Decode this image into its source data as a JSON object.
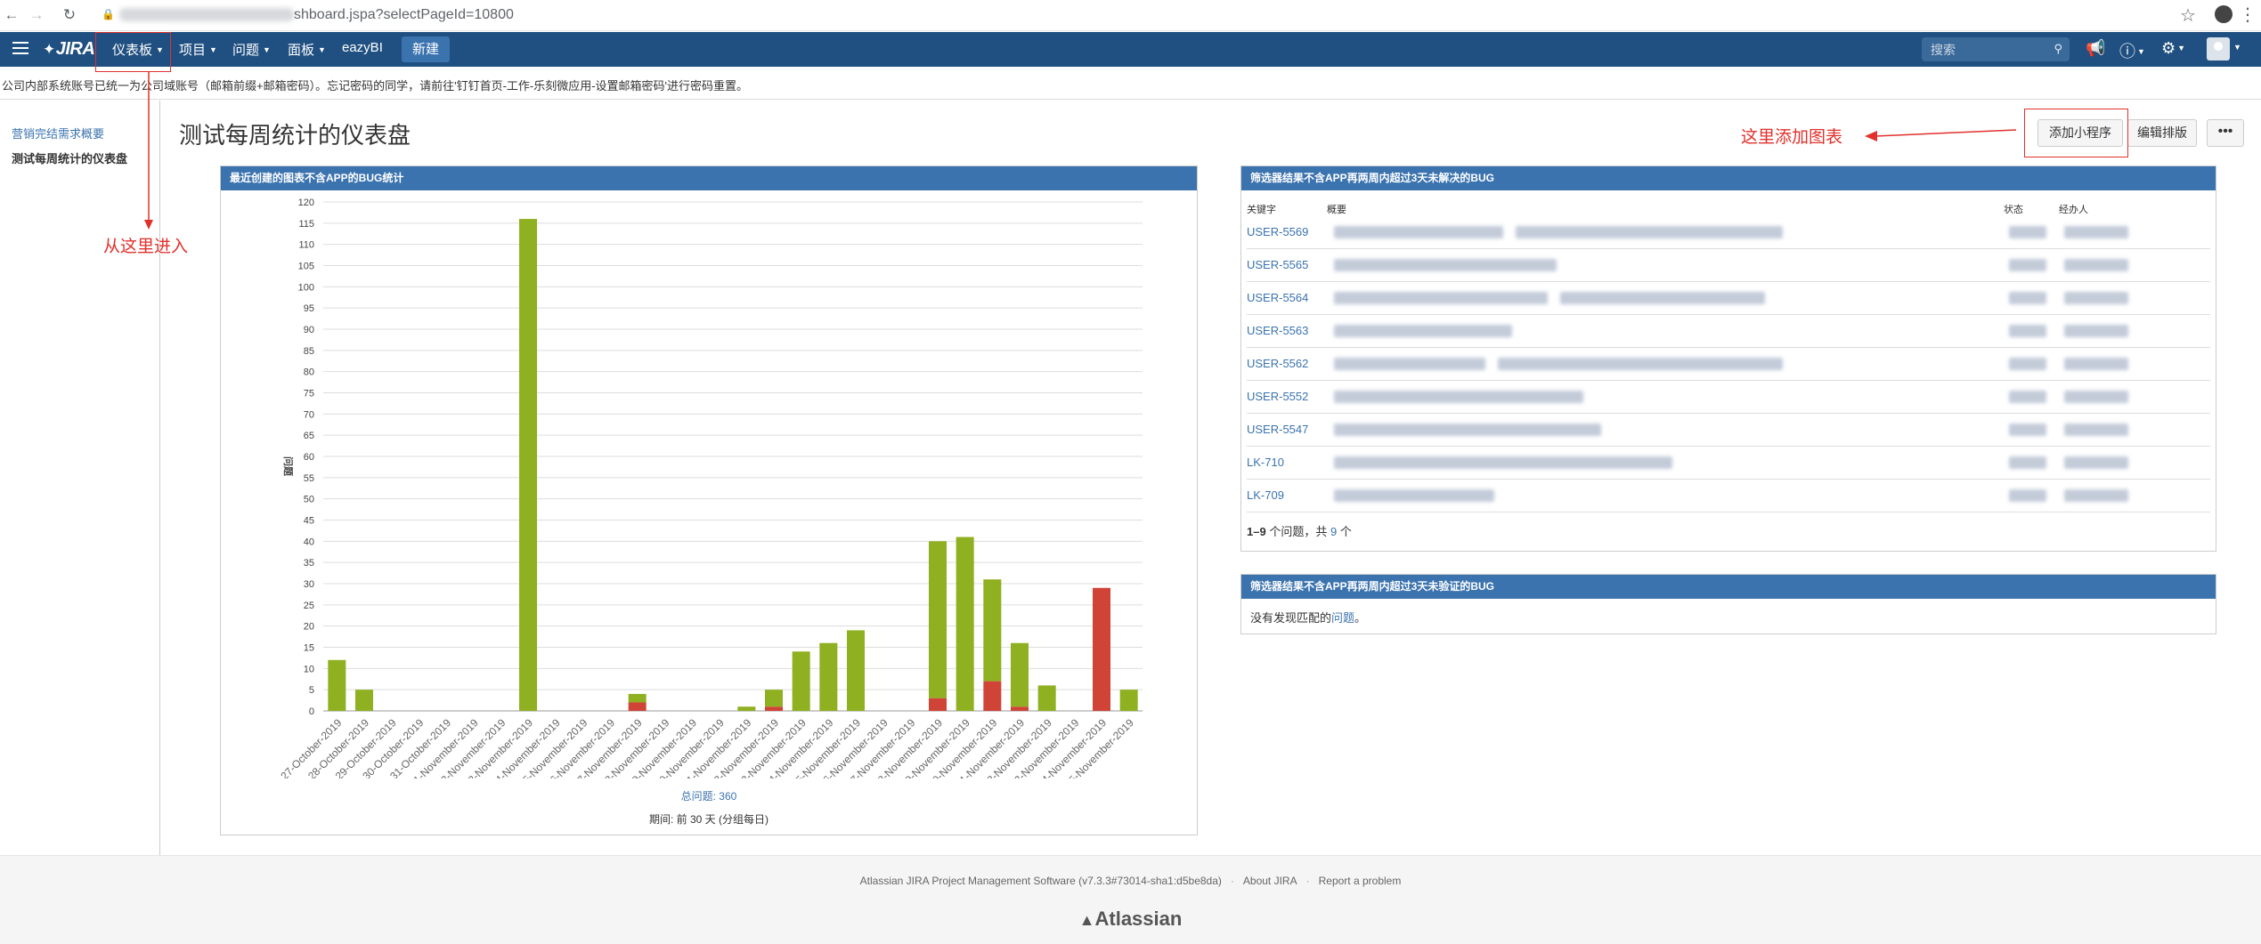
{
  "browser": {
    "url_visible": "shboard.jspa?selectPageId=10800"
  },
  "header": {
    "logo": "JIRA",
    "nav": [
      {
        "label": "仪表板"
      },
      {
        "label": "项目"
      },
      {
        "label": "问题"
      },
      {
        "label": "面板"
      },
      {
        "label": "eazyBI"
      }
    ],
    "create_label": "新建",
    "search_placeholder": "搜索"
  },
  "notice": "公司内部系统账号已统一为公司域账号（邮箱前缀+邮箱密码）。忘记密码的同学，请前往'钉钉首页-工作-乐刻微应用-设置邮箱密码'进行密码重置。",
  "sidebar": {
    "items": [
      {
        "label": "营销完结需求概要"
      },
      {
        "label": "测试每周统计的仪表盘"
      }
    ]
  },
  "dashboard": {
    "title": "测试每周统计的仪表盘",
    "add_gadget_label": "添加小程序",
    "edit_layout_label": "编辑排版",
    "more_label": "•••"
  },
  "annotations": {
    "enter_here": "从这里进入",
    "add_chart_here": "这里添加图表"
  },
  "chart_gadget": {
    "title": "最近创建的图表不含APP的BUG统计",
    "total_label": "总问题: 360",
    "period_label": "期间: 前 30 天 (分组每日)"
  },
  "chart_data": {
    "type": "bar",
    "ylabel": "问题",
    "ylim": [
      0,
      120
    ],
    "yticks": [
      0,
      5,
      10,
      15,
      20,
      25,
      30,
      35,
      40,
      45,
      50,
      55,
      60,
      65,
      70,
      75,
      80,
      85,
      90,
      95,
      100,
      105,
      110,
      115,
      120
    ],
    "categories": [
      "27-October-2019",
      "28-October-2019",
      "29-October-2019",
      "30-October-2019",
      "31-October-2019",
      "1-November-2019",
      "2-November-2019",
      "3-November-2019",
      "4-November-2019",
      "5-November-2019",
      "6-November-2019",
      "7-November-2019",
      "8-November-2019",
      "9-November-2019",
      "10-November-2019",
      "11-November-2019",
      "12-November-2019",
      "13-November-2019",
      "14-November-2019",
      "15-November-2019",
      "16-November-2019",
      "17-November-2019",
      "18-November-2019",
      "19-November-2019",
      "20-November-2019",
      "21-November-2019",
      "22-November-2019",
      "23-November-2019",
      "24-November-2019",
      "25-November-2019"
    ],
    "series": [
      {
        "color": "#d04437",
        "values": [
          0,
          0,
          0,
          0,
          0,
          0,
          0,
          0,
          0,
          0,
          0,
          2,
          0,
          0,
          0,
          0,
          1,
          0,
          0,
          0,
          0,
          0,
          3,
          0,
          7,
          1,
          0,
          0,
          29,
          0
        ]
      },
      {
        "color": "#8eb021",
        "values": [
          12,
          5,
          0,
          0,
          0,
          0,
          0,
          116,
          0,
          0,
          0,
          2,
          0,
          0,
          0,
          1,
          4,
          14,
          16,
          19,
          0,
          0,
          37,
          41,
          24,
          15,
          6,
          0,
          0,
          5
        ]
      }
    ],
    "bar_positions": [
      1,
      2,
      3,
      4,
      5,
      6,
      7,
      8,
      9,
      10,
      11,
      12,
      13,
      14,
      15,
      16,
      17,
      18,
      19,
      20,
      21,
      22,
      23,
      24,
      25,
      26,
      27,
      28,
      29,
      30
    ]
  },
  "issues_gadget": {
    "title": "筛选器结果不含APP再两周内超过3天未解决的BUG",
    "columns": {
      "key": "关键字",
      "summary": "概要",
      "status": "状态",
      "assignee": "经办人"
    },
    "rows": [
      {
        "key": "USER-5569"
      },
      {
        "key": "USER-5565"
      },
      {
        "key": "USER-5564"
      },
      {
        "key": "USER-5563"
      },
      {
        "key": "USER-5562"
      },
      {
        "key": "USER-5552"
      },
      {
        "key": "USER-5547"
      },
      {
        "key": "LK-710"
      },
      {
        "key": "LK-709"
      }
    ],
    "footer_range": "1–9",
    "footer_mid": "个问题，共",
    "footer_total": "9",
    "footer_unit": "个"
  },
  "empty_gadget": {
    "title": "筛选器结果不含APP再两周内超过3天未验证的BUG",
    "text_before": "没有发现匹配的",
    "link": "问题",
    "text_after": "。"
  },
  "footer": {
    "software": "Atlassian JIRA Project Management Software (v7.3.3#73014-sha1:d5be8da)",
    "about": "About JIRA",
    "report": "Report a problem",
    "logo": "Atlassian"
  }
}
